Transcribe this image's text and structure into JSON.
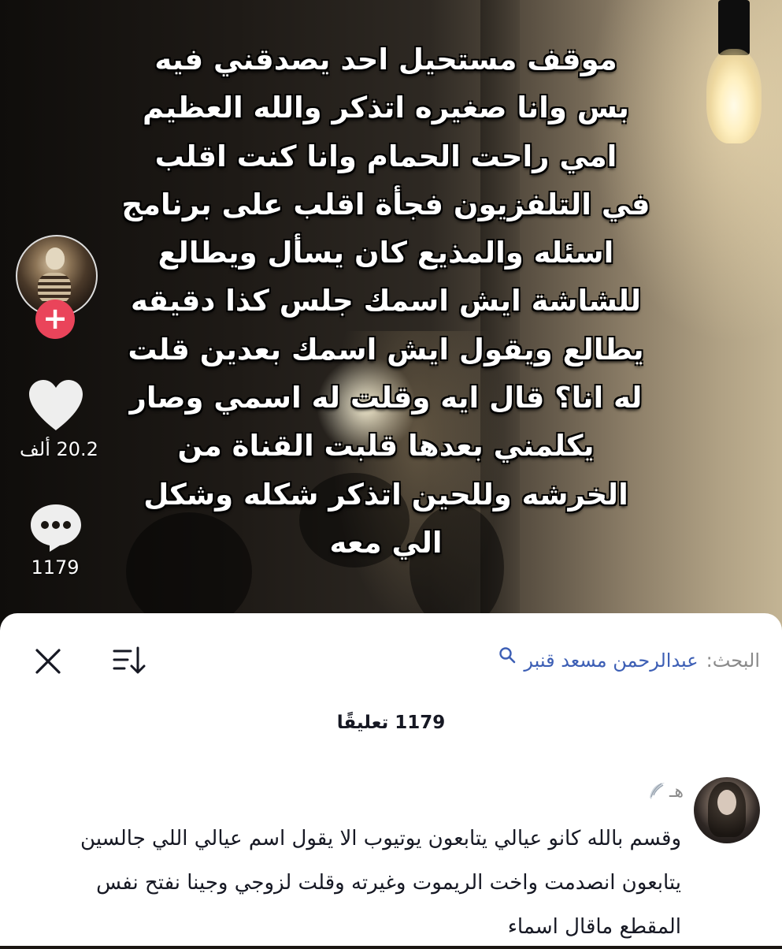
{
  "video": {
    "caption_lines": [
      "موقف مستحيل احد يصدقني فيه",
      "بس وانا صغيره اتذكر والله العظيم",
      "امي راحت الحمام وانا كنت اقلب",
      "في التلفزيون فجأة اقلب على برنامج",
      "اسئله والمذيع كان يسأل ويطالع",
      "للشاشة ايش اسمك جلس كذا دقيقه",
      "يطالع ويقول ايش اسمك بعدين قلت",
      "له انا؟ قال ايه وقلت له اسمي وصار",
      "يكلمني بعدها قلبت القناة من",
      "الخرشه وللحين اتذكر شكله وشكل",
      "الي معه"
    ],
    "follow_symbol": "+",
    "like_count": "20.2 ألف",
    "comment_count": "1179"
  },
  "sheet": {
    "search_label": "البحث:",
    "search_term": "عبدالرحمن مسعد قنبر",
    "comments_title": "1179 تعليقًا",
    "comment": {
      "username": "هـ",
      "text_lines": [
        "وقسم بالله كانو عيالي يتابعون يوتيوب الا يقول اسم عيالي اللي جالسين",
        "يتابعون انصدمت واخت الريموت وغيرته وقلت لزوجي وجينا نفتح نفس",
        "المقطع ماقال اسماء"
      ]
    }
  },
  "colors": {
    "follow": "#ea445a",
    "search_term": "#3d5fb5",
    "muted": "#8a8a8a",
    "text": "#161823"
  }
}
